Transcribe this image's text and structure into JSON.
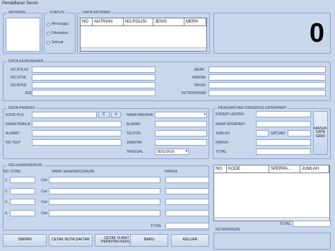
{
  "window": {
    "title": "Pendaftaran Servis"
  },
  "antrian": {
    "legend": "ANTRIAN",
    "status_legend": "STATUS",
    "status_options": [
      "Menunggu",
      "Dikerjakan",
      "Selesai"
    ],
    "data_legend": "DATA ANTRIAN",
    "columns": [
      "NO",
      "ANTRIAN",
      "NO.POLISI",
      "JENIS",
      "MERK"
    ],
    "counter_value": "0"
  },
  "kendaraan": {
    "legend": "DATA KENDARAAN",
    "left_labels": [
      "NO.POLISI",
      "NO.STNK",
      "NO.BPKB",
      "JENIS"
    ],
    "right_labels": [
      "MERK",
      "WARNA",
      "TAHUN",
      "KETERANGAN"
    ]
  },
  "pribadi": {
    "legend": "DATA PRIBADI",
    "labels": [
      "KODE PLG",
      "NAMA PEMILIK",
      "ALAMAT",
      "NO.TELP"
    ],
    "kode_btn": "C",
    "mekanik_labels": [
      "NAMA MEKANIK",
      "ALAMAT",
      "TELPON",
      "JABATAN",
      "TANGGAL"
    ],
    "tanggal_value": "05/11/2016"
  },
  "onderdil": {
    "legend": "PERGANTIAN ONDERDIL/SPERPART",
    "labels": [
      "KODE/P LENTER",
      "NAMA SPERPART",
      "JUMLAH",
      "HARGA",
      "TOTAL"
    ],
    "satuan_label": "SATUAN",
    "masuk_btn": "MASUK DATA GRID",
    "grid_columns": [
      "NO",
      "KODE",
      "SPERPA...",
      "JUMLAH"
    ],
    "total_label": "TOTAL",
    "keterangan_label": "KETERANGAN"
  },
  "keluhan": {
    "legend": "KELUHAN/SERVIS",
    "col_no": "NO. KODE",
    "col_nama": "NAMA JASA/KERUSAKAN",
    "col_harga": "HARGA",
    "rows": [
      "1.",
      "2.",
      "3.",
      "4."
    ],
    "cari_label": "Cari",
    "total_label": "TOTAL"
  },
  "buttons": {
    "simpan": "SIMPAN",
    "cetak_nota": "CETAK NOTA DAFTAR",
    "cetak_surat": "CETAK SURAT PERINTAH KERJA",
    "baru": "BARU",
    "keluar": "KELUAR"
  }
}
